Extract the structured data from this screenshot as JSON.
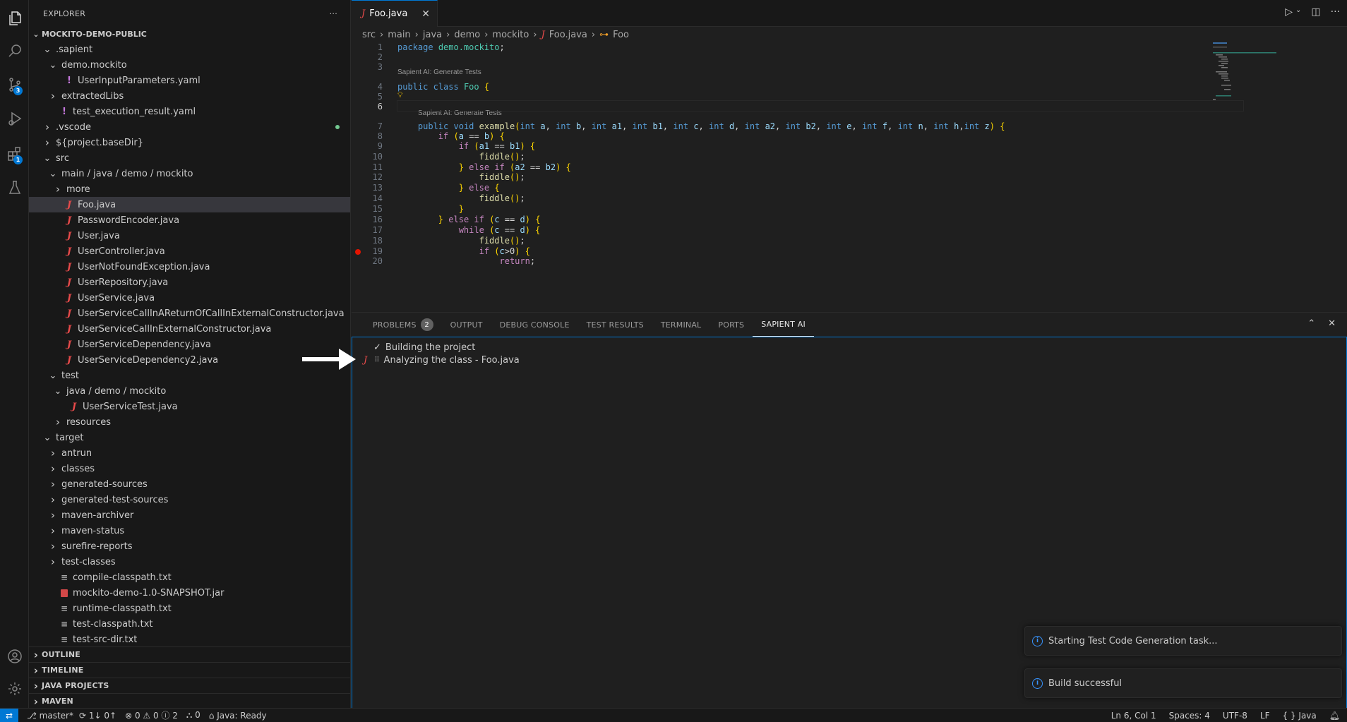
{
  "explorer": {
    "title": "EXPLORER",
    "more": "···",
    "root": "MOCKITO-DEMO-PUBLIC",
    "tree": [
      {
        "label": ".sapient",
        "twisty": "open",
        "icon": ""
      },
      {
        "label": "demo.mockito",
        "twisty": "open",
        "icon": ""
      },
      {
        "label": "UserInputParameters.yaml",
        "twisty": "",
        "icon": "excl"
      },
      {
        "label": "extractedLibs",
        "twisty": "closed",
        "icon": ""
      },
      {
        "label": "test_execution_result.yaml",
        "twisty": "",
        "icon": "excl"
      },
      {
        "label": ".vscode",
        "twisty": "closed",
        "icon": ""
      },
      {
        "label": "${project.baseDir}",
        "twisty": "closed",
        "icon": ""
      },
      {
        "label": "src",
        "twisty": "open",
        "icon": ""
      },
      {
        "label": "main / java / demo / mockito",
        "twisty": "open",
        "icon": ""
      },
      {
        "label": "more",
        "twisty": "closed",
        "icon": ""
      },
      {
        "label": "Foo.java",
        "twisty": "",
        "icon": "java"
      },
      {
        "label": "PasswordEncoder.java",
        "twisty": "",
        "icon": "java"
      },
      {
        "label": "User.java",
        "twisty": "",
        "icon": "java"
      },
      {
        "label": "UserController.java",
        "twisty": "",
        "icon": "java"
      },
      {
        "label": "UserNotFoundException.java",
        "twisty": "",
        "icon": "java"
      },
      {
        "label": "UserRepository.java",
        "twisty": "",
        "icon": "java"
      },
      {
        "label": "UserService.java",
        "twisty": "",
        "icon": "java"
      },
      {
        "label": "UserServiceCallInAReturnOfCallInExternalConstructor.java",
        "twisty": "",
        "icon": "java"
      },
      {
        "label": "UserServiceCallInExternalConstructor.java",
        "twisty": "",
        "icon": "java"
      },
      {
        "label": "UserServiceDependency.java",
        "twisty": "",
        "icon": "java"
      },
      {
        "label": "UserServiceDependency2.java",
        "twisty": "",
        "icon": "java"
      },
      {
        "label": "test",
        "twisty": "open",
        "icon": ""
      },
      {
        "label": "java / demo / mockito",
        "twisty": "open",
        "icon": ""
      },
      {
        "label": "UserServiceTest.java",
        "twisty": "",
        "icon": "java"
      },
      {
        "label": "resources",
        "twisty": "closed",
        "icon": ""
      },
      {
        "label": "target",
        "twisty": "open",
        "icon": ""
      },
      {
        "label": "antrun",
        "twisty": "closed",
        "icon": ""
      },
      {
        "label": "classes",
        "twisty": "closed",
        "icon": ""
      },
      {
        "label": "generated-sources",
        "twisty": "closed",
        "icon": ""
      },
      {
        "label": "generated-test-sources",
        "twisty": "closed",
        "icon": ""
      },
      {
        "label": "maven-archiver",
        "twisty": "closed",
        "icon": ""
      },
      {
        "label": "maven-status",
        "twisty": "closed",
        "icon": ""
      },
      {
        "label": "surefire-reports",
        "twisty": "closed",
        "icon": ""
      },
      {
        "label": "test-classes",
        "twisty": "closed",
        "icon": ""
      },
      {
        "label": "compile-classpath.txt",
        "twisty": "",
        "icon": "lines"
      },
      {
        "label": "mockito-demo-1.0-SNAPSHOT.jar",
        "twisty": "",
        "icon": "jar"
      },
      {
        "label": "runtime-classpath.txt",
        "twisty": "",
        "icon": "lines"
      },
      {
        "label": "test-classpath.txt",
        "twisty": "",
        "icon": "lines"
      },
      {
        "label": "test-src-dir.txt",
        "twisty": "",
        "icon": "lines"
      }
    ],
    "selected": "Foo.java",
    "sections": [
      "OUTLINE",
      "TIMELINE",
      "JAVA PROJECTS",
      "MAVEN"
    ]
  },
  "activity_bar": {
    "scm_badge": "3",
    "extensions_badge": "1"
  },
  "editor": {
    "tab_label": "Foo.java",
    "breadcrumb": [
      "src",
      "main",
      "java",
      "demo",
      "mockito",
      "Foo.java",
      "Foo"
    ],
    "codelens": "Sapient AI: Generate Tests",
    "code": [
      {
        "n": "1",
        "t": "package demo.mockito;"
      },
      {
        "n": "2",
        "t": ""
      },
      {
        "n": "3",
        "t": ""
      },
      {
        "n": "4",
        "t": "public class Foo {"
      },
      {
        "n": "5",
        "t": ""
      },
      {
        "n": "6",
        "t": ""
      },
      {
        "n": "7",
        "t": "    public void example(int a, int b, int a1, int b1, int c, int d, int a2, int b2, int e, int f, int n, int h,int z) {"
      },
      {
        "n": "8",
        "t": "        if (a == b) {"
      },
      {
        "n": "9",
        "t": "            if (a1 == b1) {"
      },
      {
        "n": "10",
        "t": "                fiddle();"
      },
      {
        "n": "11",
        "t": "            } else if (a2 == b2) {"
      },
      {
        "n": "12",
        "t": "                fiddle();"
      },
      {
        "n": "13",
        "t": "            } else {"
      },
      {
        "n": "14",
        "t": "                fiddle();"
      },
      {
        "n": "15",
        "t": "            }"
      },
      {
        "n": "16",
        "t": "        } else if (c == d) {"
      },
      {
        "n": "17",
        "t": "            while (c == d) {"
      },
      {
        "n": "18",
        "t": "                fiddle();"
      },
      {
        "n": "19",
        "t": "                if (c>0) {"
      },
      {
        "n": "20",
        "t": "                    return;"
      }
    ]
  },
  "panel": {
    "tabs": [
      "PROBLEMS",
      "OUTPUT",
      "DEBUG CONSOLE",
      "TEST RESULTS",
      "TERMINAL",
      "PORTS",
      "SAPIENT AI"
    ],
    "problems_count": "2",
    "active_tab": "SAPIENT AI",
    "log": [
      {
        "icon": "✓",
        "text": "Building the project"
      },
      {
        "icon": "⠿",
        "text": "Analyzing the class - Foo.java"
      }
    ]
  },
  "notifications": [
    {
      "text": "Starting Test Code Generation task..."
    },
    {
      "text": "Build successful"
    }
  ],
  "status_bar": {
    "branch": "master*",
    "sync": "1↓ 0↑",
    "errors": "0",
    "warnings": "0",
    "infos": "2",
    "ports": "0",
    "java": "Java: Ready",
    "position": "Ln 6, Col 1",
    "spaces": "Spaces: 4",
    "encoding": "UTF-8",
    "eol": "LF",
    "language": "Java"
  },
  "colors": {
    "accent": "#0078d4",
    "java_icon": "#e84a4a",
    "breakpoint": "#e51400"
  }
}
